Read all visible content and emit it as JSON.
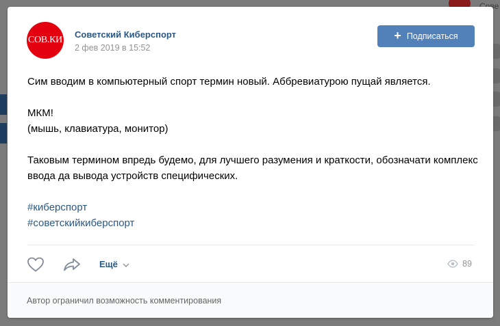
{
  "background": {
    "partial_text": "Сове"
  },
  "post": {
    "author": "Советский Киберспорт",
    "avatar_text": "СОВ.КИ",
    "date": "2 фев 2019 в 15:52",
    "subscribe_label": "Подписаться",
    "paragraphs": {
      "p1": "Сим вводим в компьютерный спорт термин новый. Аббревиатурою пущай является.",
      "p2_line1": "МКМ!",
      "p2_line2": "(мышь, клавиатура, монитор)",
      "p3": "Таковым термином впредь будемо, для лучшего разумения и краткости, обозначати комплекс ввода да вывода устройств специфических."
    },
    "hashtags": [
      "#киберспорт",
      "#советскийкиберспорт"
    ],
    "actions": {
      "more_label": "Ещё",
      "views": "89"
    },
    "comments_notice": "Автор ограничил возможность комментирования"
  },
  "colors": {
    "link": "#2a5885",
    "button": "#5181b8",
    "avatar": "#e3000f",
    "meta": "#939393"
  }
}
